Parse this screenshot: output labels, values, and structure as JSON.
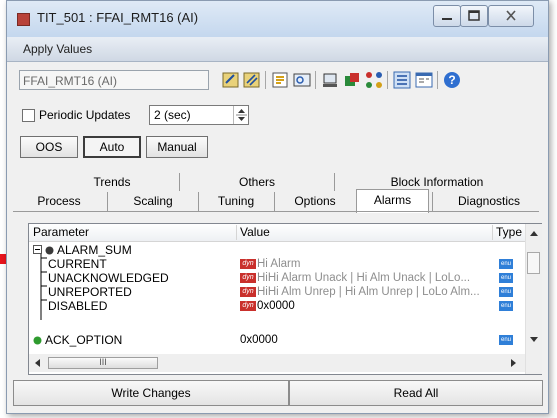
{
  "window": {
    "title": "TIT_501 : FFAI_RMT16 (AI)"
  },
  "apply_bar": {
    "label": "Apply Values"
  },
  "toolbar": {
    "tag_value": "FFAI_RMT16 (AI)"
  },
  "periodic": {
    "checkbox_label": "Periodic Updates",
    "checked": false,
    "interval_value": "2 (sec)"
  },
  "mode_buttons": {
    "oos": "OOS",
    "auto": "Auto",
    "manual": "Manual",
    "selected": "Auto"
  },
  "tabs": {
    "top_row": [
      "Trends",
      "Others",
      "Block Information"
    ],
    "bottom_row": [
      "Process",
      "Scaling",
      "Tuning",
      "Options",
      "Alarms",
      "Diagnostics"
    ],
    "active": "Alarms"
  },
  "grid": {
    "columns": [
      "Parameter",
      "Value",
      "Type"
    ],
    "rows": [
      {
        "parameter": "ALARM_SUM",
        "value": "",
        "expanded": true
      },
      {
        "parameter": "CURRENT",
        "value": "Hi Alarm"
      },
      {
        "parameter": "UNACKNOWLEDGED",
        "value": "HiHi Alarm Unack | Hi Alm Unack | LoLo..."
      },
      {
        "parameter": "UNREPORTED",
        "value": "HiHi Alm Unrep | Hi Alm Unrep | LoLo Alm..."
      },
      {
        "parameter": "DISABLED",
        "value": "0x0000"
      },
      {
        "parameter": "ACK_OPTION",
        "value": "0x0000"
      }
    ],
    "type_icon_label": "dyn",
    "hscroll_grip": "III"
  },
  "bottom_buttons": {
    "write": "Write Changes",
    "read": "Read All"
  },
  "colors": {
    "accent_arrow": "#e8141c",
    "dyn_badge": "#c9302c",
    "type_icon": "#2f7fd8",
    "status_dot": "#2e9b2e"
  }
}
